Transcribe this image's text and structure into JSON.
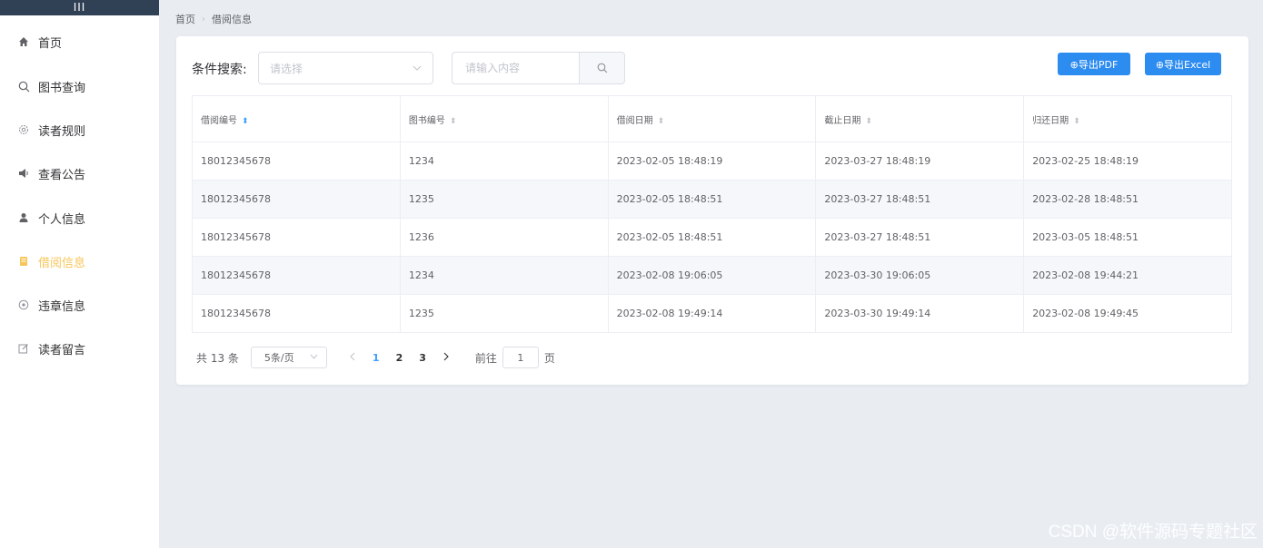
{
  "sidebar": {
    "toggle": "III",
    "items": [
      {
        "label": "首页",
        "icon": "home-icon",
        "active": false
      },
      {
        "label": "图书查询",
        "icon": "search-icon",
        "active": false
      },
      {
        "label": "读者规则",
        "icon": "settings-icon",
        "active": false
      },
      {
        "label": "查看公告",
        "icon": "speaker-icon",
        "active": false
      },
      {
        "label": "个人信息",
        "icon": "user-icon",
        "active": false
      },
      {
        "label": "借阅信息",
        "icon": "document-icon",
        "active": true
      },
      {
        "label": "违章信息",
        "icon": "warning-icon",
        "active": false
      },
      {
        "label": "读者留言",
        "icon": "edit-icon",
        "active": false
      }
    ]
  },
  "breadcrumb": {
    "home": "首页",
    "current": "借阅信息"
  },
  "search": {
    "label": "条件搜索:",
    "select_placeholder": "请选择",
    "input_placeholder": "请输入内容"
  },
  "buttons": {
    "export_pdf": "⊕导出PDF",
    "export_excel": "⊕导出Excel"
  },
  "table": {
    "headers": [
      "借阅编号",
      "图书编号",
      "借阅日期",
      "截止日期",
      "归还日期"
    ],
    "rows": [
      [
        "18012345678",
        "1234",
        "2023-02-05 18:48:19",
        "2023-03-27 18:48:19",
        "2023-02-25 18:48:19"
      ],
      [
        "18012345678",
        "1235",
        "2023-02-05 18:48:51",
        "2023-03-27 18:48:51",
        "2023-02-28 18:48:51"
      ],
      [
        "18012345678",
        "1236",
        "2023-02-05 18:48:51",
        "2023-03-27 18:48:51",
        "2023-03-05 18:48:51"
      ],
      [
        "18012345678",
        "1234",
        "2023-02-08 19:06:05",
        "2023-03-30 19:06:05",
        "2023-02-08 19:44:21"
      ],
      [
        "18012345678",
        "1235",
        "2023-02-08 19:49:14",
        "2023-03-30 19:49:14",
        "2023-02-08 19:49:45"
      ]
    ]
  },
  "pagination": {
    "total": "共 13 条",
    "page_size": "5条/页",
    "pages": [
      "1",
      "2",
      "3"
    ],
    "current_page": "1",
    "goto_label": "前往",
    "goto_value": "1",
    "goto_suffix": "页"
  },
  "watermark": "CSDN @软件源码专题社区",
  "colors": {
    "accent": "#409eff",
    "button": "#2d8cf0",
    "active_menu": "#f7c65a",
    "sidebar_top": "#304156"
  }
}
